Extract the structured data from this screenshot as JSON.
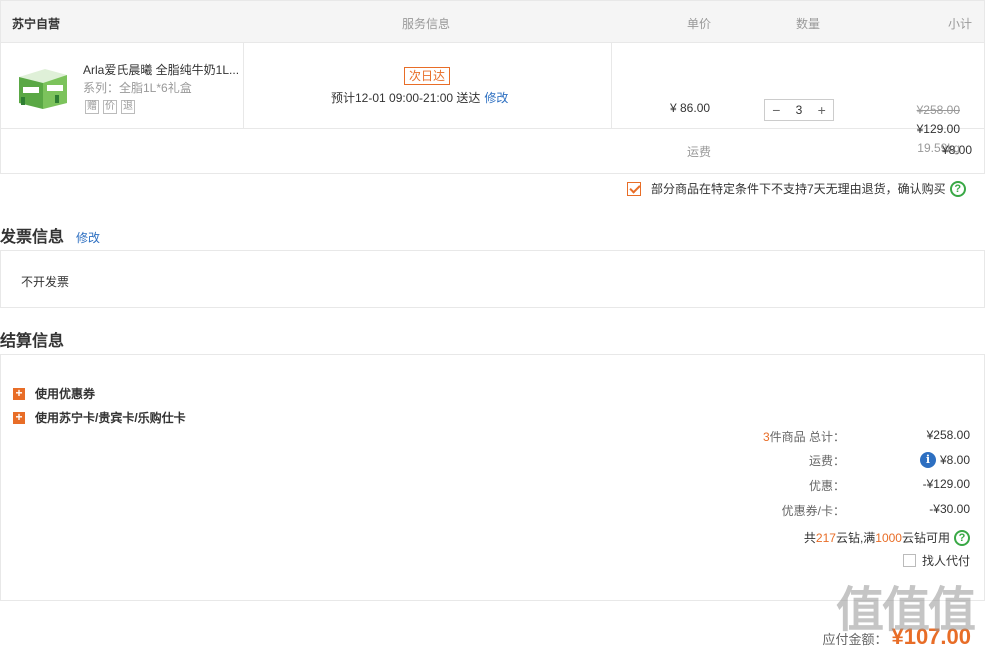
{
  "table": {
    "headers": {
      "shop": "苏宁自营",
      "service": "服务信息",
      "unit_price": "单价",
      "quantity": "数量",
      "subtotal": "小计"
    },
    "item": {
      "name": "Arla爱氏晨曦 全脂纯牛奶1L...",
      "spec": "系列：全脂1L*6礼盒",
      "badges": [
        "赠",
        "价",
        "退"
      ],
      "delivery_badge": "次日达",
      "eta": "预计12-01  09:00-21:00 送达",
      "eta_edit": "修改",
      "unit_price": "¥ 86.00",
      "quantity": "3",
      "qty_minus": "−",
      "qty_plus": "+",
      "original_total": "¥258.00",
      "total": "¥129.00",
      "weight": "19.59kg"
    },
    "shipping_label": "运费",
    "shipping_value": "¥8.00"
  },
  "confirm_text": "部分商品在特定条件下不支持7天无理由退货，确认购买",
  "help_icon": "?",
  "invoice": {
    "title": "发票信息",
    "edit": "修改",
    "value": "不开发票"
  },
  "settlement": {
    "title": "结算信息",
    "options": [
      "使用优惠券",
      "使用苏宁卡/贵宾卡/乐购仕卡"
    ],
    "lines": [
      {
        "count": "3",
        "label": "件商品 总计：",
        "value": "¥258.00"
      },
      {
        "label": "运费：",
        "value": "¥8.00"
      },
      {
        "label": "优惠：",
        "value": "-¥129.00"
      },
      {
        "label": "优惠券/卡：",
        "value": "-¥30.00"
      }
    ],
    "coins_prefix": "共",
    "coins_amount": "217",
    "coins_mid": "云钻,满",
    "coins_threshold": "1000",
    "coins_suffix": "云钻可用",
    "proxy_pay": "找人代付"
  },
  "payable": {
    "label": "应付金额：",
    "value": "¥107.00"
  },
  "watermark": "值值值",
  "colors": {
    "accent": "#e86d27",
    "link": "#2d6fc1",
    "help": "#39a845"
  }
}
